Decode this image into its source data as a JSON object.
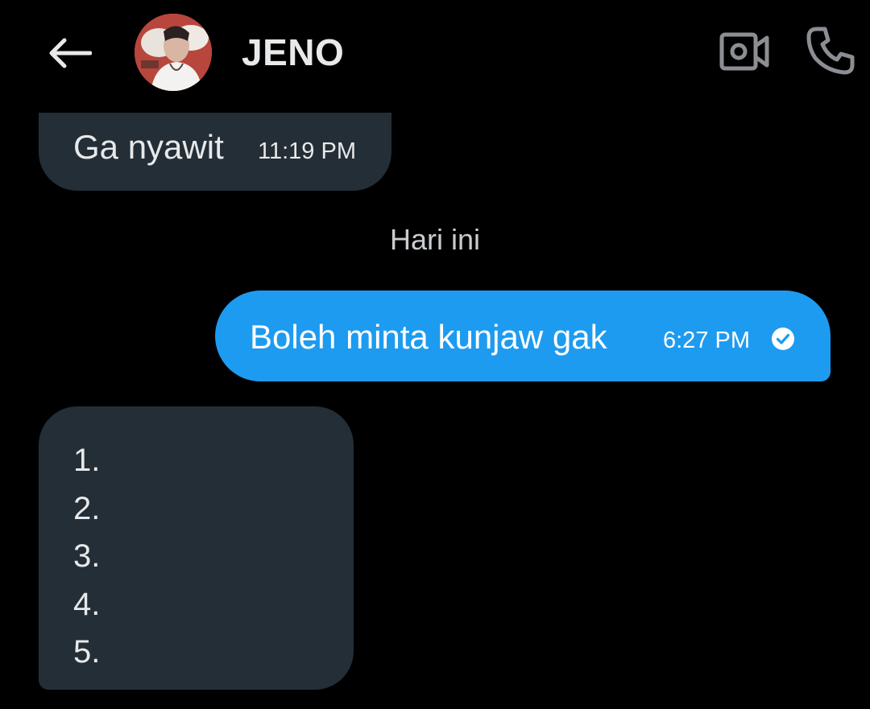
{
  "header": {
    "contact_name": "JENO",
    "back_icon": "arrow-left-icon",
    "video_icon": "video-camera-icon",
    "phone_icon": "phone-icon"
  },
  "messages": {
    "previous": {
      "text": "Ga nyawit",
      "time": "11:19 PM"
    },
    "day_divider": "Hari ini",
    "outgoing": {
      "text": "Boleh minta kunjaw gak",
      "time": "6:27 PM",
      "status_icon": "read-check-icon"
    },
    "list": {
      "items": [
        "1.",
        "2.",
        "3.",
        "4.",
        "5."
      ]
    }
  },
  "colors": {
    "background": "#000000",
    "incoming_bubble": "#242e36",
    "outgoing_bubble": "#1d9bf0",
    "text": "#e7e9ea",
    "icon_gray": "#8b8f94"
  }
}
